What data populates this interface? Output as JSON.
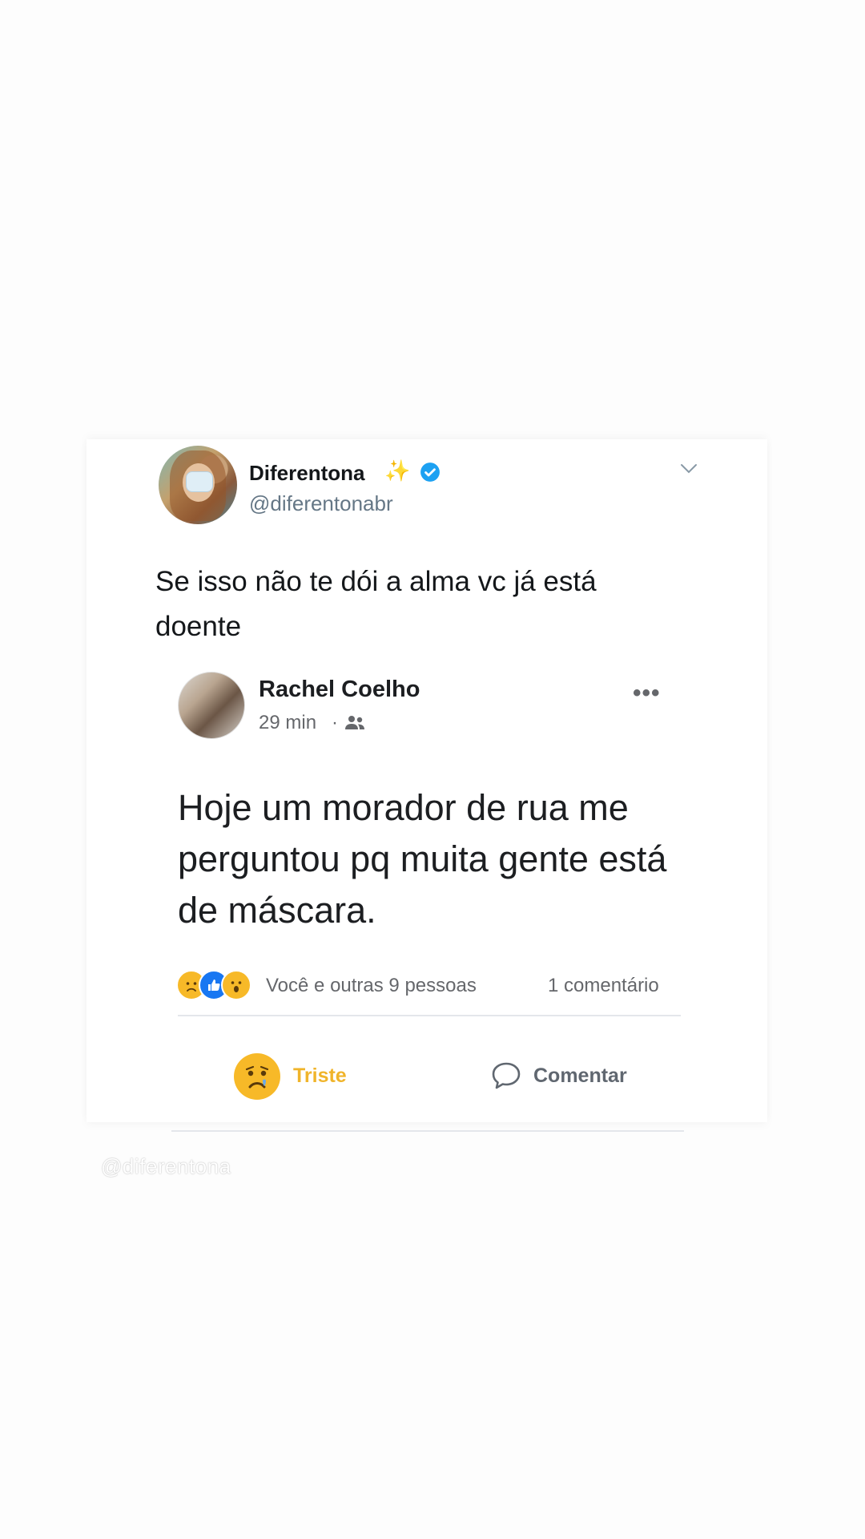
{
  "tweet": {
    "name": "Diferentona",
    "name_emoji": "✨",
    "handle": "@diferentonabr",
    "text": "Se isso não te dói a alma vc já está doente"
  },
  "embedded_post": {
    "author": "Rachel Coelho",
    "time": "29 min",
    "separator": "·",
    "more": "•••",
    "text": "Hoje um morador de rua me perguntou pq muita gente está de máscara.",
    "reactions_summary": "Você e outras 9 pessoas",
    "comments_count": "1 comentário",
    "reaction_button_label": "Triste",
    "comment_button_label": "Comentar",
    "reaction_icons": [
      "sad-emoji",
      "like-icon",
      "wow-emoji"
    ]
  },
  "watermark": "@diferentona",
  "colors": {
    "twitter_verified": "#1da1f2",
    "facebook_blue": "#1877f2",
    "reaction_yellow": "#f7b928",
    "triste_label": "#f0b42a"
  }
}
